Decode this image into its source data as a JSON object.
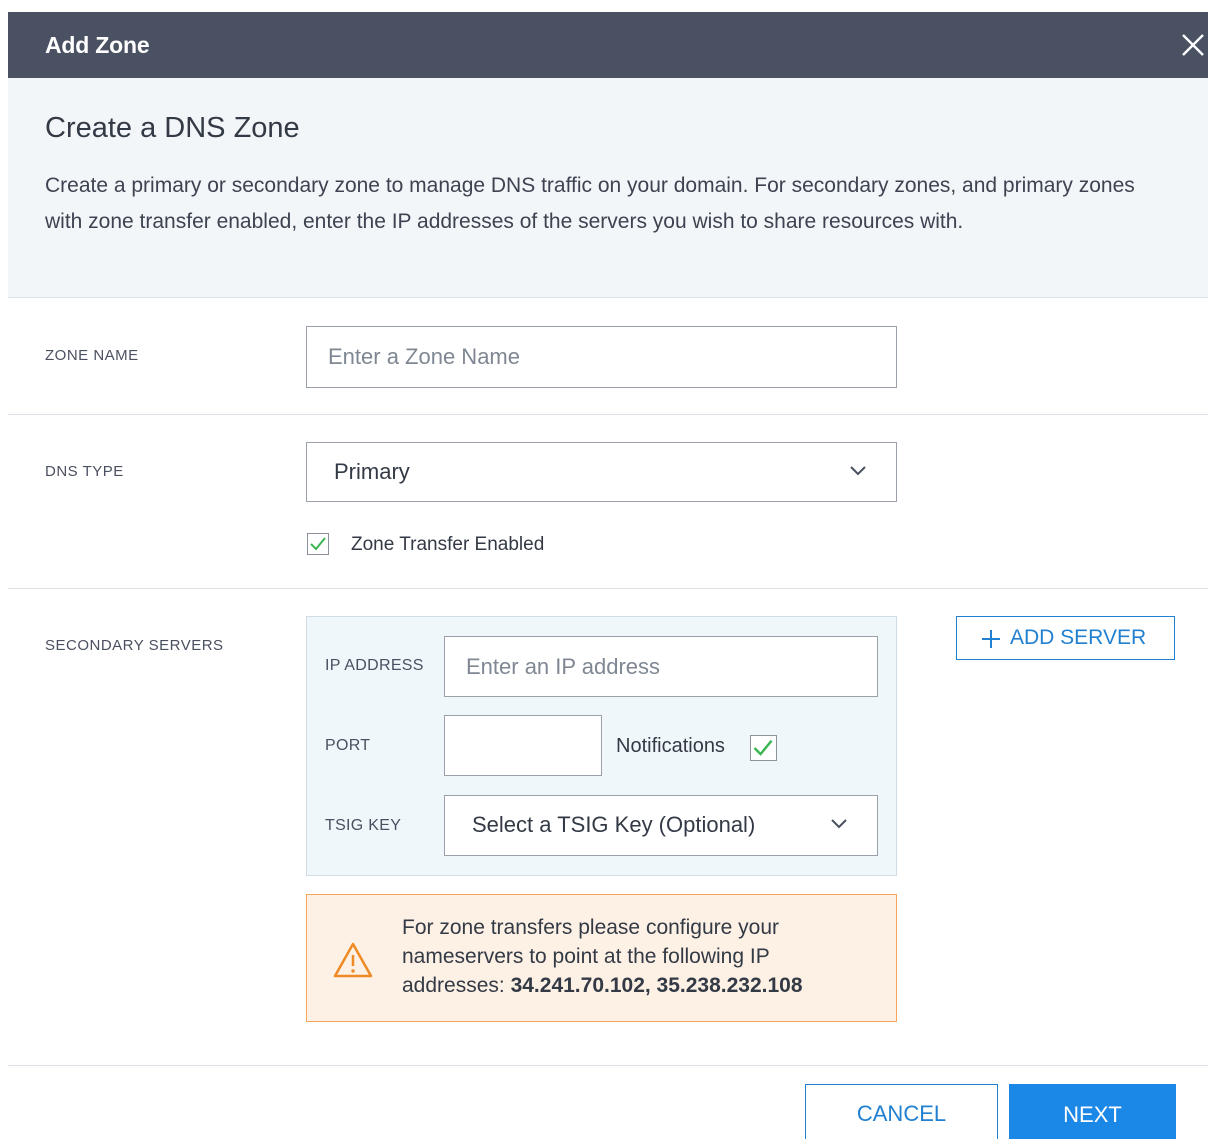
{
  "dialog": {
    "title": "Add Zone",
    "heading": "Create a DNS Zone",
    "description": "Create a primary or secondary zone to manage DNS traffic on your domain. For secondary zones, and primary zones with zone transfer enabled, enter the IP addresses of the servers you wish to share resources with."
  },
  "zone_name": {
    "label": "ZONE NAME",
    "placeholder": "Enter a Zone Name",
    "value": ""
  },
  "dns_type": {
    "label": "DNS TYPE",
    "selected": "Primary",
    "zone_transfer_label": "Zone Transfer Enabled",
    "zone_transfer_checked": true
  },
  "secondary_servers": {
    "label": "SECONDARY SERVERS",
    "ip_label": "IP ADDRESS",
    "ip_placeholder": "Enter an IP address",
    "port_label": "PORT",
    "port_value": "",
    "notifications_label": "Notifications",
    "notifications_checked": true,
    "tsig_label": "TSIG KEY",
    "tsig_selected": "Select a TSIG Key (Optional)",
    "add_server_label": "ADD SERVER"
  },
  "warning": {
    "text": "For zone transfers please configure your nameservers to point at the following IP addresses:",
    "ips": "34.241.70.102, 35.238.232.108"
  },
  "footer": {
    "cancel_label": "CANCEL",
    "next_label": "NEXT"
  },
  "colors": {
    "header_bg": "#4a5163",
    "accent": "#1b87e6",
    "check": "#3cb553",
    "warning_border": "#f5a55d"
  }
}
